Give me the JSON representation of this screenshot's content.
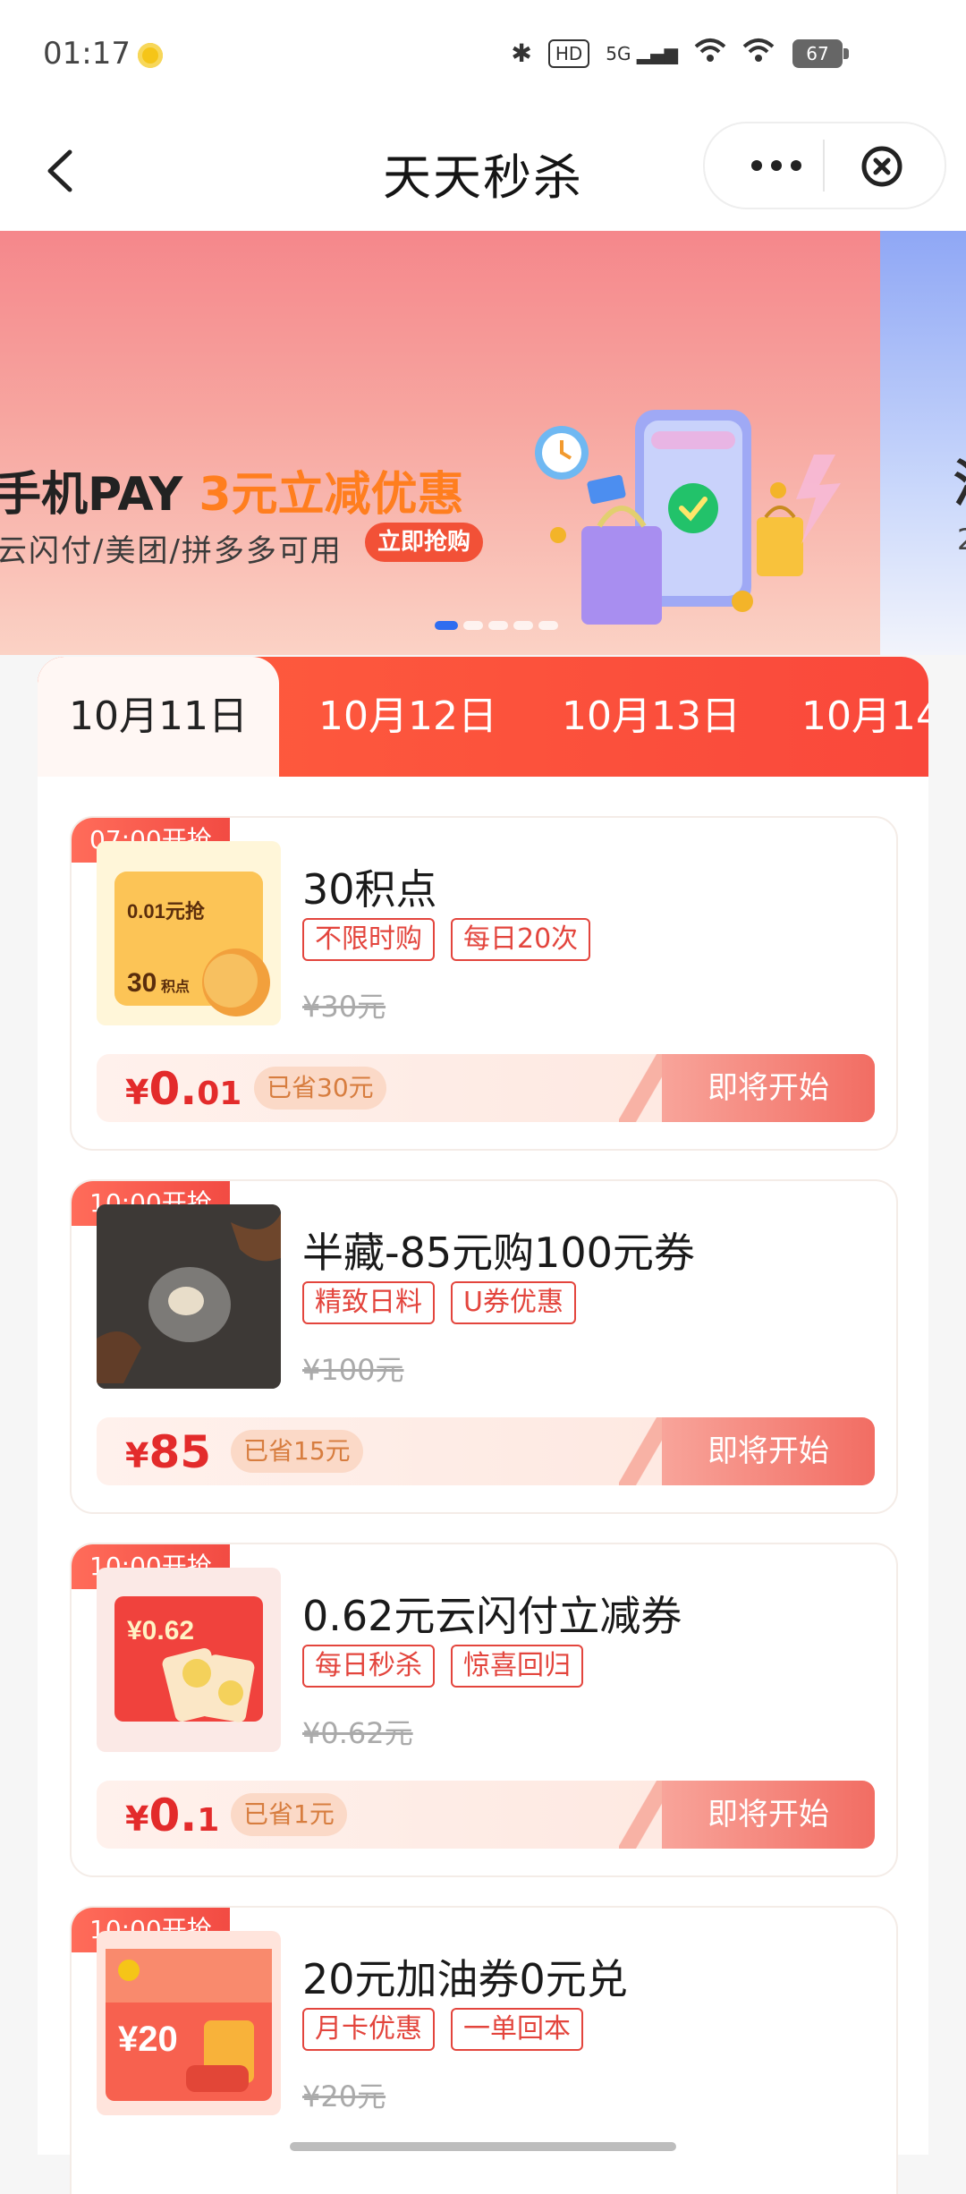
{
  "status_bar": {
    "time": "01:17",
    "hd": "HD",
    "network": "5G",
    "battery": "67"
  },
  "header": {
    "title": "天天秒杀"
  },
  "banner": {
    "headline_main": "手机PAY ",
    "headline_highlight": "3元立减优惠",
    "subtitle": "云闪付/美团/拼多多可用",
    "cta": "立即抢购",
    "next_fragment_1": "消",
    "next_fragment_2": "2",
    "slide_count": 5,
    "active_slide": 1
  },
  "tabs": [
    {
      "label": "10月11日",
      "active": true
    },
    {
      "label": "10月12日",
      "active": false
    },
    {
      "label": "10月13日",
      "active": false
    },
    {
      "label": "10月14",
      "active": false
    }
  ],
  "products": [
    {
      "start_label": "07:00开抢",
      "name": "30积点",
      "tags": [
        "不限时购",
        "每日20次"
      ],
      "original_price": "¥30元",
      "price_currency": "¥",
      "price_int": "0.",
      "price_dec": "01",
      "saved": "已省30元",
      "cta": "即将开始",
      "thumb_text_1": "0.01元抢",
      "thumb_text_2": "30",
      "thumb_text_3": "积点"
    },
    {
      "start_label": "10:00开抢",
      "name": "半藏-85元购100元券",
      "tags": [
        "精致日料",
        "U券优惠"
      ],
      "original_price": "¥100元",
      "price_currency": "¥",
      "price_int": "85",
      "price_dec": "",
      "saved": "已省15元",
      "cta": "即将开始"
    },
    {
      "start_label": "10:00开抢",
      "name": "0.62元云闪付立减券",
      "tags": [
        "每日秒杀",
        "惊喜回归"
      ],
      "original_price": "¥0.62元",
      "price_currency": "¥",
      "price_int": "0.",
      "price_dec": "1",
      "saved": "已省1元",
      "cta": "即将开始",
      "thumb_text_1": "¥0.62"
    },
    {
      "start_label": "10:00开抢",
      "name": "20元加油券0元兑",
      "tags": [
        "月卡优惠",
        "一单回本"
      ],
      "original_price": "¥20元",
      "thumb_text_1": "¥20"
    }
  ],
  "colors": {
    "accent": "#f24b43",
    "tag": "#e3453d",
    "price": "#e32b2b",
    "saved_text": "#d77d3f"
  }
}
